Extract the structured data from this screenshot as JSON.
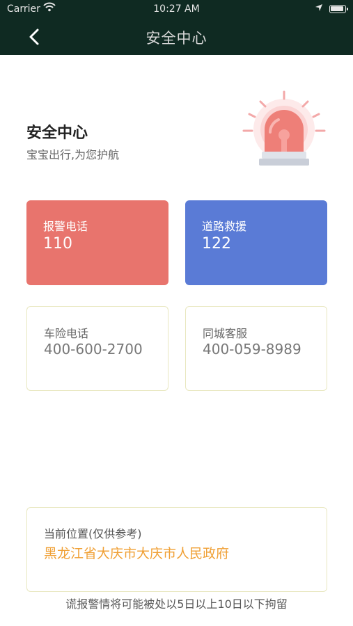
{
  "status_bar": {
    "carrier": "Carrier",
    "time": "10:27 AM"
  },
  "nav": {
    "title": "安全中心",
    "back_icon": "chevron-left-icon"
  },
  "header": {
    "title": "安全中心",
    "subtitle": "宝宝出行,为您护航",
    "illustration": "siren-alarm-icon"
  },
  "cards": {
    "police": {
      "label": "报警电话",
      "number": "110",
      "color": "#e8746d"
    },
    "road_rescue": {
      "label": "道路救援",
      "number": "122",
      "color": "#5a7bd6"
    },
    "insurance": {
      "label": "车险电话",
      "number": "400-600-2700"
    },
    "city_service": {
      "label": "同城客服",
      "number": "400-059-8989"
    }
  },
  "location": {
    "label": "当前位置(仅供参考)",
    "value": "黑龙江省大庆市大庆市人民政府",
    "value_color": "#f0a035"
  },
  "footer": {
    "note": "谎报警情将可能被处以5日以上10日以下拘留"
  },
  "colors": {
    "nav_bg": "#0f2a22",
    "outline_border": "#e8e7bf"
  }
}
